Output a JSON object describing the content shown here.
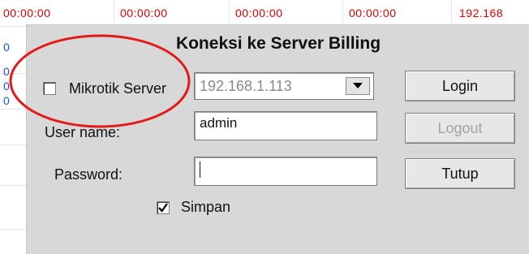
{
  "background": {
    "times": [
      "00:00:00",
      "00:00:00",
      "00:00:00",
      "00:00:00"
    ],
    "ip_partial": "192.168",
    "left_marks": [
      "0",
      "0",
      "0",
      "0"
    ]
  },
  "dialog": {
    "title": "Koneksi ke Server Billing",
    "mikrotik_label": "Mikrotik Server",
    "mikrotik_checked": false,
    "server_value": "192.168.1.113",
    "username_label": "User name:",
    "username_value": "admin",
    "password_label": "Password:",
    "password_value": "",
    "remember_label": "Simpan",
    "remember_checked": true,
    "buttons": {
      "login": "Login",
      "logout": "Logout",
      "close": "Tutup"
    }
  },
  "colors": {
    "annotation_circle": "#e21a1a",
    "bg_time_text": "#e00000"
  }
}
